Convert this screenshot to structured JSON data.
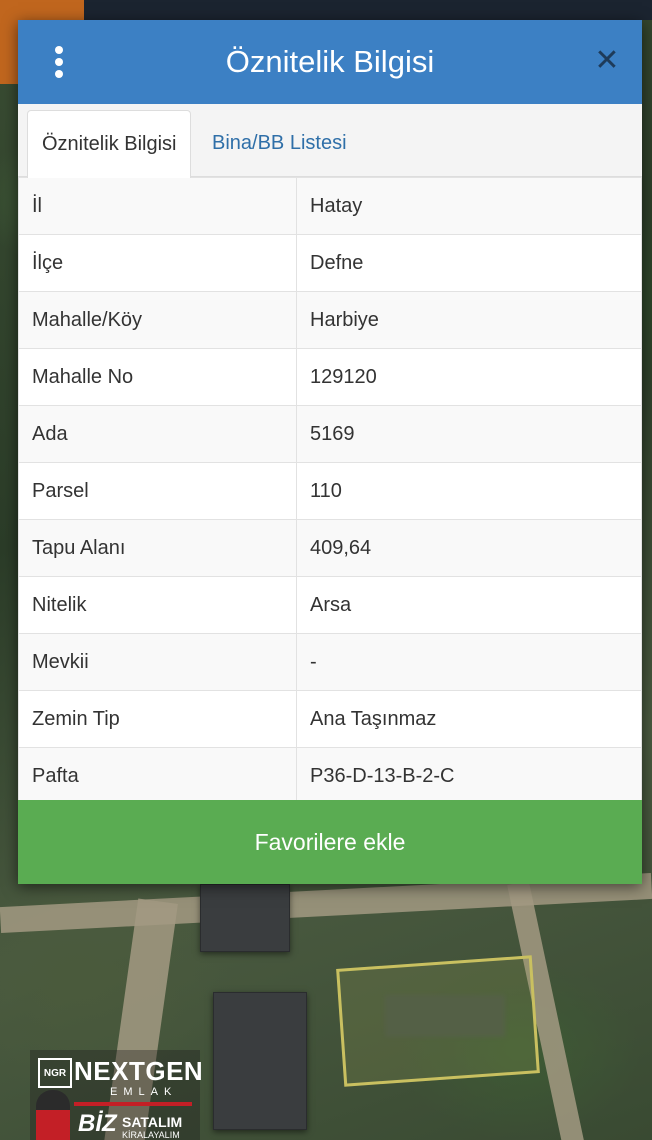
{
  "dialog": {
    "title": "Öznitelik Bilgisi",
    "menu_icon": "vertical-dots-icon",
    "close_icon": "close-icon",
    "header_color": "#3c80c4"
  },
  "tabs": [
    {
      "label": "Öznitelik Bilgisi",
      "active": true
    },
    {
      "label": "Bina/BB Listesi",
      "active": false
    }
  ],
  "attributes": [
    {
      "key": "İl",
      "value": "Hatay"
    },
    {
      "key": "İlçe",
      "value": "Defne"
    },
    {
      "key": "Mahalle/Köy",
      "value": "Harbiye"
    },
    {
      "key": "Mahalle No",
      "value": "129120"
    },
    {
      "key": "Ada",
      "value": "5169"
    },
    {
      "key": "Parsel",
      "value": "110"
    },
    {
      "key": "Tapu Alanı",
      "value": "409,64"
    },
    {
      "key": "Nitelik",
      "value": "Arsa"
    },
    {
      "key": "Mevkii",
      "value": "-"
    },
    {
      "key": "Zemin Tip",
      "value": "Ana Taşınmaz"
    },
    {
      "key": "Pafta",
      "value": "P36-D-13-B-2-C"
    }
  ],
  "favorite_button": {
    "label": "Favorilere ekle",
    "color": "#5aac52"
  },
  "logo": {
    "badge": "NGR",
    "brand": "NEXTGEN",
    "sub": "EMLAK",
    "biz": "BİZ",
    "line1": "SATALIM",
    "line2": "KİRALAYALIM"
  }
}
